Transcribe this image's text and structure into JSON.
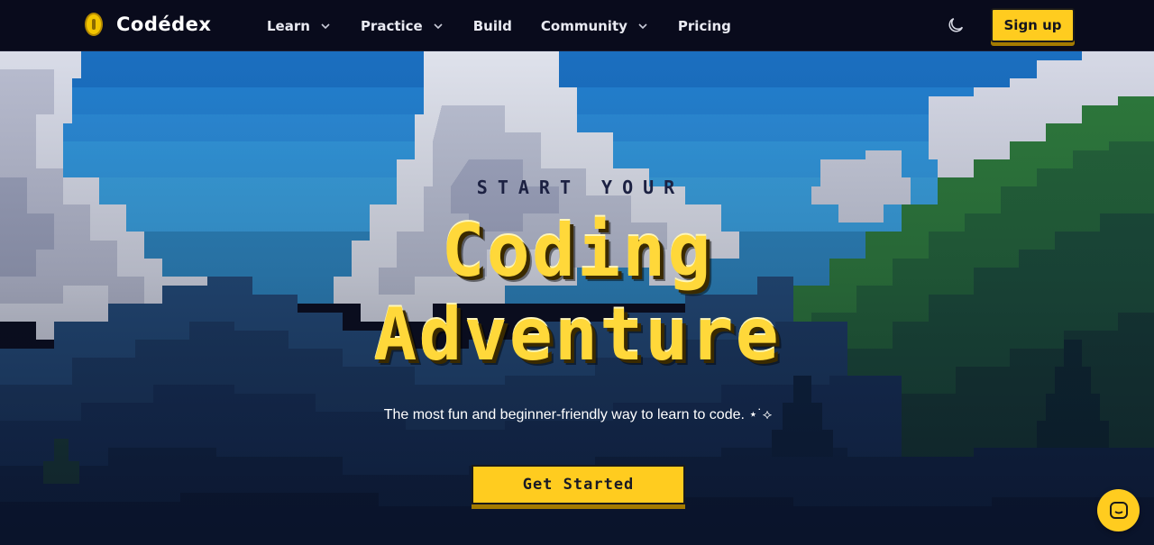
{
  "nav": {
    "brand": "Codédex",
    "links": [
      {
        "label": "Learn",
        "has_dropdown": true
      },
      {
        "label": "Practice",
        "has_dropdown": true
      },
      {
        "label": "Build",
        "has_dropdown": false
      },
      {
        "label": "Community",
        "has_dropdown": true
      },
      {
        "label": "Pricing",
        "has_dropdown": false
      }
    ],
    "theme_icon": "moon-icon",
    "signup_label": "Sign up"
  },
  "hero": {
    "eyebrow": "START YOUR",
    "title_line1": "Coding",
    "title_line2": "Adventure",
    "subtitle": "The most fun and beginner-friendly way to learn to code. ⋆˙⟡",
    "cta_label": "Get Started"
  },
  "chat": {
    "icon": "chat-icon"
  },
  "colors": {
    "accent": "#ffcc1f",
    "nav_bg": "#090b1c",
    "title_yellow": "#ffd83a",
    "eyebrow_navy": "#1c2142"
  }
}
